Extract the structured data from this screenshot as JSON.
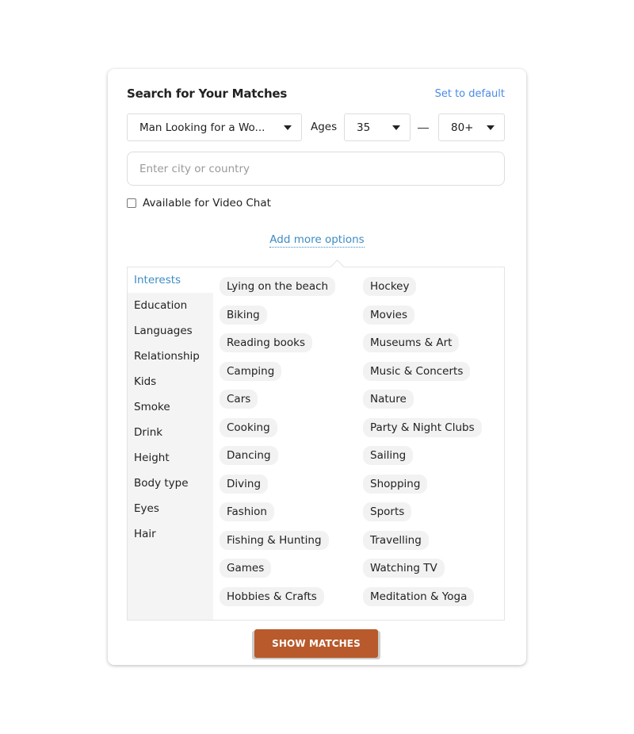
{
  "header": {
    "title": "Search for Your Matches",
    "set_default": "Set to default"
  },
  "filters": {
    "gender": "Man Looking for a Wo...",
    "ages_label": "Ages",
    "age_from": "35",
    "age_to": "80+",
    "city_placeholder": "Enter city or country",
    "city_value": "",
    "video_chat_label": "Available for Video Chat",
    "video_chat_checked": false,
    "add_more": "Add more options"
  },
  "categories": [
    {
      "label": "Interests",
      "active": true
    },
    {
      "label": "Education"
    },
    {
      "label": "Languages"
    },
    {
      "label": "Relationship"
    },
    {
      "label": "Kids"
    },
    {
      "label": "Smoke"
    },
    {
      "label": "Drink"
    },
    {
      "label": "Height"
    },
    {
      "label": "Body type"
    },
    {
      "label": "Eyes"
    },
    {
      "label": "Hair"
    }
  ],
  "interests_col1": [
    "Lying on the beach",
    "Biking",
    "Reading books",
    "Camping",
    "Cars",
    "Cooking",
    "Dancing",
    "Diving",
    "Fashion",
    "Fishing & Hunting",
    "Games",
    "Hobbies & Crafts"
  ],
  "interests_col2": [
    "Hockey",
    "Movies",
    "Museums & Art",
    "Music & Concerts",
    "Nature",
    "Party & Night Clubs",
    "Sailing",
    "Shopping",
    "Sports",
    "Travelling",
    "Watching TV",
    "Meditation & Yoga"
  ],
  "actions": {
    "show_matches": "SHOW MATCHES"
  },
  "colors": {
    "accent_link": "#4a8ae8",
    "active_tab": "#3d8cc4",
    "button": "#b85a2b"
  }
}
